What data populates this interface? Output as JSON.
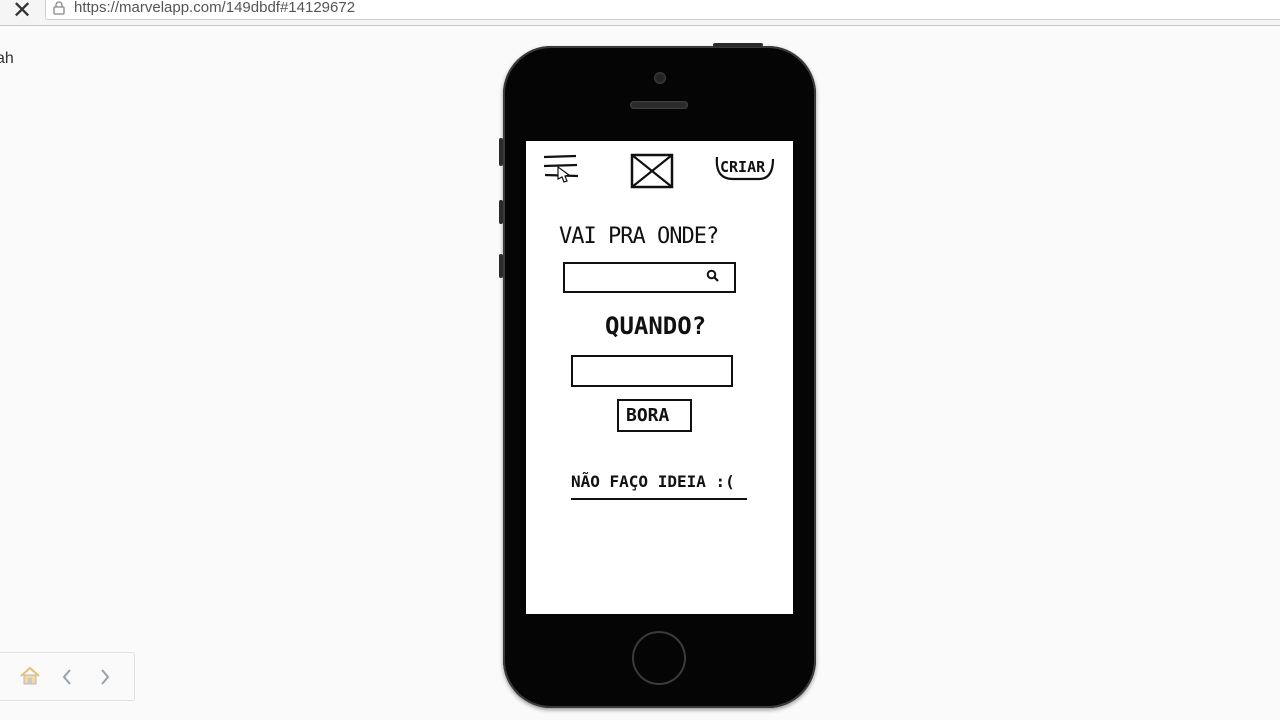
{
  "browser": {
    "url": "https://marvelapp.com/149dbdf#14129672"
  },
  "side_text": "ah",
  "prototype": {
    "criar_label": "CRIAR",
    "question_where": "VAI PRA ONDE?",
    "question_when": "QUANDO?",
    "bora_label": "BORA",
    "no_idea_link": "NÃO FAÇO IDEIA :("
  },
  "icons": {
    "menu": "hamburger-icon",
    "logo": "image-placeholder-icon",
    "search": "search-icon",
    "home": "home-icon",
    "back": "chevron-left-icon",
    "forward": "chevron-right-icon"
  }
}
